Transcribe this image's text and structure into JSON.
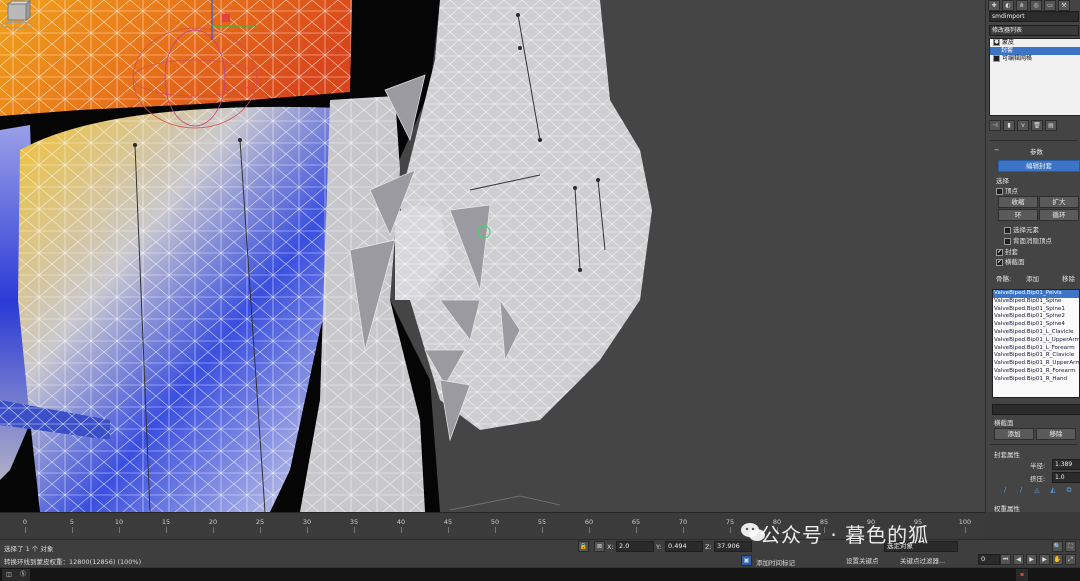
{
  "colors": {
    "accent": "#3c75c8",
    "viewport_bg": "#454545",
    "weight_red": "#e25a1c",
    "weight_yellow": "#f2c12e",
    "weight_blue": "#2a3bd6"
  },
  "command_panel": {
    "object_name": "smdimport",
    "modifier_list": "修改器列表",
    "stack": [
      {
        "label": "蒙皮",
        "selected": false
      },
      {
        "label": "封套",
        "selected": true
      },
      {
        "label": "可编辑网格",
        "selected": false
      }
    ],
    "params_header": "参数",
    "edit_envelope_button": "编辑封套",
    "select_section": "选择",
    "vertices_label": "顶点",
    "shrink_button": "收缩",
    "grow_button": "扩大",
    "ring_button": "环",
    "loop_button": "循环",
    "select_element_label": "选择元素",
    "backface_cull_label": "背面消隐顶点",
    "envelopes_label": "封套",
    "cross_sections_label": "横截面",
    "bones_label": "骨骼:",
    "add_bone_button": "添加",
    "remove_bone_button": "移除",
    "bones": [
      {
        "name": "ValveBiped.Bip01_Pelvis",
        "selected": true
      },
      {
        "name": "ValveBiped.Bip01_Spine",
        "selected": false
      },
      {
        "name": "ValveBiped.Bip01_Spine1",
        "selected": false
      },
      {
        "name": "ValveBiped.Bip01_Spine2",
        "selected": false
      },
      {
        "name": "ValveBiped.Bip01_Spine4",
        "selected": false
      },
      {
        "name": "ValveBiped.Bip01_L_Clavicle",
        "selected": false
      },
      {
        "name": "ValveBiped.Bip01_L_UpperArm",
        "selected": false
      },
      {
        "name": "ValveBiped.Bip01_L_Forearm",
        "selected": false
      },
      {
        "name": "ValveBiped.Bip01_R_Clavicle",
        "selected": false
      },
      {
        "name": "ValveBiped.Bip01_R_UpperArm",
        "selected": false
      },
      {
        "name": "ValveBiped.Bip01_R_Forearm",
        "selected": false
      },
      {
        "name": "ValveBiped.Bip01_R_Hand",
        "selected": false
      }
    ],
    "cross_section_header": "横截面",
    "cs_add_button": "添加",
    "cs_remove_button": "移除",
    "envelope_props_header": "封套属性",
    "radius_label": "半径:",
    "radius_value": "1.389",
    "squash_label": "挤压:",
    "squash_value": "1.0",
    "weight_props_header": "权重属性",
    "abs_effect_label": "绝对效果"
  },
  "timeline": {
    "ticks": [
      0,
      5,
      10,
      15,
      20,
      25,
      30,
      35,
      40,
      45,
      50,
      55,
      60,
      65,
      70,
      75,
      80,
      85,
      90,
      95,
      100
    ]
  },
  "status": {
    "selection": "选择了 1 个 对象",
    "prompt": "转换环线到蒙皮权重：12800(12856) (100%)",
    "x_label": "X:",
    "x_value": "2.0",
    "y_label": "Y:",
    "y_value": "0.494",
    "z_label": "Z:",
    "z_value": "37.906",
    "add_time_tag": "添加时间标记",
    "set_key": "设置关键点",
    "key_filters": "关键点过滤器...",
    "selected_object": "选定对象",
    "frame_value": "0"
  },
  "watermark": "公众号 · 暮色的狐"
}
